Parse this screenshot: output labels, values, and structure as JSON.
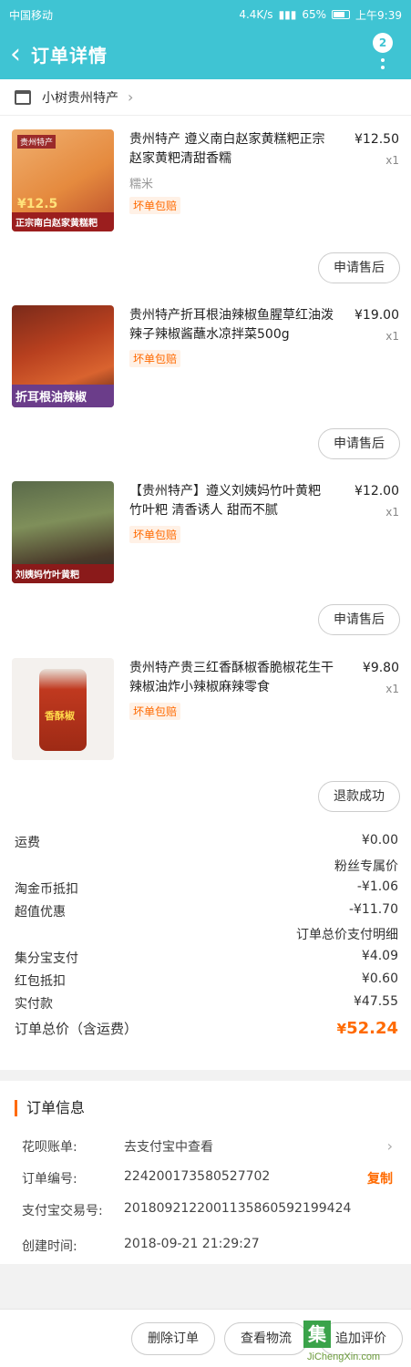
{
  "status": {
    "carrier": "中国移动",
    "speed": "4.4K/s",
    "battery": "65%",
    "time": "上午9:39"
  },
  "nav": {
    "title": "订单详情",
    "badge": "2"
  },
  "shop": {
    "name": "小树贵州特产"
  },
  "items": [
    {
      "title": "贵州特产 遵义南白赵家黄糕粑正宗赵家黄粑清甜香糯",
      "price": "¥12.50",
      "qty": "x1",
      "sku": "糯米",
      "tag": "坏单包赔",
      "action": "申请售后",
      "thumb_caption": "正宗南白赵家黄糕粑",
      "thumb_price": "¥12.5",
      "thumb_label": "贵州特产"
    },
    {
      "title": "贵州特产折耳根油辣椒鱼腥草红油泼辣子辣椒酱蘸水凉拌菜500g",
      "price": "¥19.00",
      "qty": "x1",
      "tag": "坏单包赔",
      "action": "申请售后",
      "thumb_caption": "折耳根油辣椒"
    },
    {
      "title": "【贵州特产】遵义刘姨妈竹叶黄粑 竹叶粑 清香诱人 甜而不腻",
      "price": "¥12.00",
      "qty": "x1",
      "tag": "坏单包赔",
      "action": "申请售后",
      "thumb_caption": "刘姨妈竹叶黄粑"
    },
    {
      "title": "贵州特产贵三红香酥椒香脆椒花生干辣椒油炸小辣椒麻辣零食",
      "price": "¥9.80",
      "qty": "x1",
      "tag": "坏单包赔",
      "action": "退款成功",
      "thumb_caption": "香酥椒"
    }
  ],
  "summary": {
    "freight_label": "运费",
    "freight_value": "¥0.00",
    "fan_price": "粉丝专属价",
    "taojinbi_label": "淘金币抵扣",
    "taojinbi_value": "-¥1.06",
    "chaozhi_label": "超值优惠",
    "chaozhi_value": "-¥11.70",
    "detail_link": "订单总价支付明细",
    "jifenbao_label": "集分宝支付",
    "jifenbao_value": "¥4.09",
    "hongbao_label": "红包抵扣",
    "hongbao_value": "¥0.60",
    "paid_label": "实付款",
    "paid_value": "¥47.55",
    "total_label": "订单总价（含运费）",
    "total_currency": "¥",
    "total_value": "52.24"
  },
  "order_info": {
    "title": "订单信息",
    "huabei_label": "花呗账单:",
    "huabei_value": "去支付宝中查看",
    "order_no_label": "订单编号:",
    "order_no_value": "224200173580527702",
    "copy_label": "复制",
    "alipay_label": "支付宝交易号:",
    "alipay_value": "2018092122001135860592199424",
    "created_label": "创建时间:",
    "created_value": "2018-09-21 21:29:27"
  },
  "bottom": {
    "delete_label": "删除订单",
    "logistics_label": "查看物流",
    "review_label": "追加评价"
  },
  "watermark": {
    "logo_char": "集",
    "site": "JiChengXin.com"
  },
  "colors": {
    "brand": "#3fc4d3",
    "accent": "#ff6a00"
  }
}
